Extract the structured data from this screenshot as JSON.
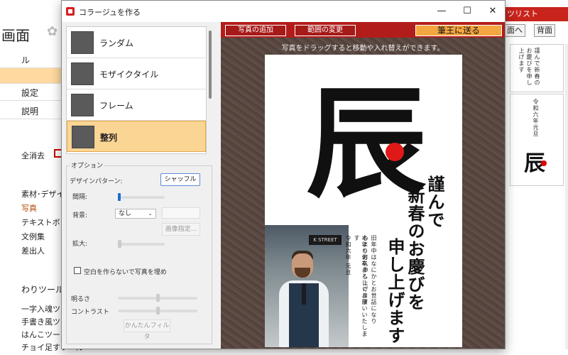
{
  "bg_left": {
    "title": "画面",
    "items": [
      "ル",
      "",
      "設定",
      "説明"
    ],
    "clear_all": "全消去",
    "sections": [
      "素材･デザイ",
      "写真",
      "テキストボック",
      "文例集",
      "差出人"
    ],
    "tools_header": "わりツール",
    "tools": [
      "一字入魂ツー",
      "手書き風ツー",
      "はんこツール",
      "チョイ足すツール"
    ]
  },
  "bg_right": {
    "bar_label": "ツリスト",
    "btn_prev": "面へ",
    "btn_next": "背面",
    "card1_text": "謹んで新春のお慶びを申し上げます",
    "card2_text": "令和六年元旦",
    "mini_kanji": "辰"
  },
  "dialog": {
    "title": "コラージュを作る",
    "controls": {
      "minimize": "—",
      "maximize": "☐",
      "close": "✕"
    }
  },
  "layouts": [
    {
      "label": "ランダム",
      "selected": false
    },
    {
      "label": "モザイクタイル",
      "selected": false
    },
    {
      "label": "フレーム",
      "selected": false
    },
    {
      "label": "整列",
      "selected": true
    }
  ],
  "options": {
    "panel_title": "オプション",
    "design_pattern_label": "デザインパターン:",
    "shuffle_button": "シャッフル",
    "spacing_label": "間隔:",
    "background_label": "背景:",
    "background_value": "なし",
    "image_spec_button": "画像指定...",
    "zoom_label": "拡大:",
    "no_gap_label": "空白を作らないで写真を埋め",
    "brightness_label": "明るさ",
    "contrast_label": "コントラスト",
    "easy_filter_button": "かんたんフィルタ"
  },
  "preview": {
    "add_photo_button": "写真の追加",
    "change_range_button": "範囲の変更",
    "send_button": "筆王に送る",
    "hint": "写真をドラッグすると移動や入れ替えができます。",
    "card": {
      "big_kanji": "辰",
      "greeting_lines": [
        "謹んで",
        "新春のお慶びを",
        "申し上げます"
      ],
      "message_lines": [
        "旧年中はなにかとお世話になり",
        "心よりお礼申し上げます",
        "本年も何卒よろしくお願いいたします",
        "令和六年 元旦"
      ],
      "street_sign": "K STREET"
    }
  },
  "colors": {
    "accent_red": "#b21d1b",
    "send_orange": "#f4a640",
    "selection": "#fbd594",
    "slider_blue": "#1b6fd1"
  }
}
